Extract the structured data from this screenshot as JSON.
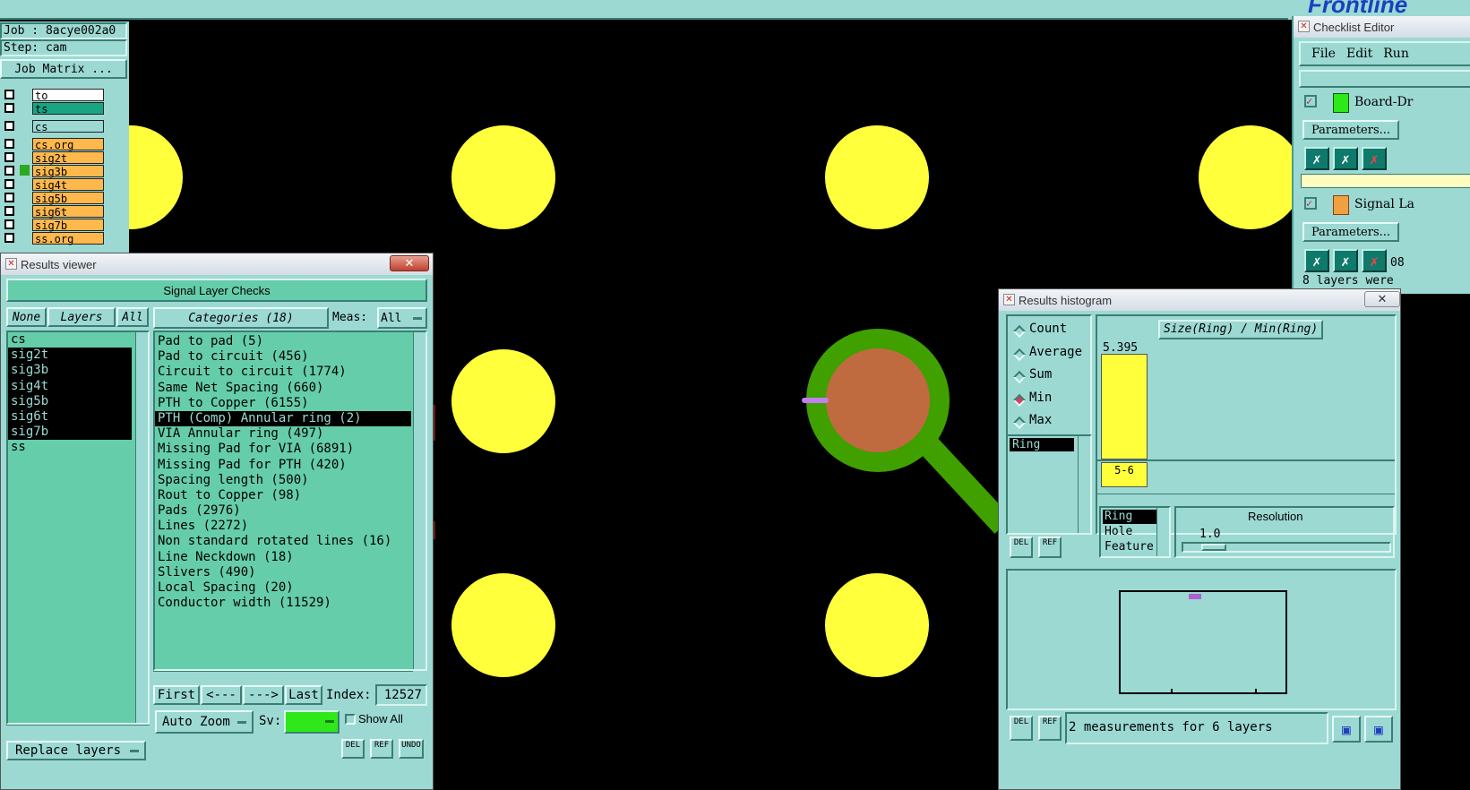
{
  "topbar": {
    "brand": "Frontline"
  },
  "job_panel": {
    "job": "Job : 8acye002a0",
    "step": "Step: cam",
    "matrix_button": "Job Matrix ...",
    "layers": [
      {
        "name": "to",
        "color": "#ffffff",
        "selected": false
      },
      {
        "name": "ts",
        "color": "#1aa582",
        "selected": false
      },
      {
        "name": "cs",
        "color": "#9cd9d3",
        "selected": false
      },
      {
        "name": "cs.org",
        "color": "#ffb84c",
        "selected": false
      },
      {
        "name": "sig2t",
        "color": "#ffb84c",
        "selected": false
      },
      {
        "name": "sig3b",
        "color": "#ffb84c",
        "selected": true
      },
      {
        "name": "sig4t",
        "color": "#ffb84c",
        "selected": false
      },
      {
        "name": "sig5b",
        "color": "#ffb84c",
        "selected": false
      },
      {
        "name": "sig6t",
        "color": "#ffb84c",
        "selected": false
      },
      {
        "name": "sig7b",
        "color": "#ffb84c",
        "selected": false
      },
      {
        "name": "ss.org",
        "color": "#ffb84c",
        "selected": false
      }
    ]
  },
  "results_viewer": {
    "title": "Results viewer",
    "close": "✕",
    "header": "Signal Layer Checks",
    "none_btn": "None",
    "layers_btn": "Layers",
    "all_btn": "All",
    "categories_btn": "Categories (18)",
    "meas_label": "Meas:",
    "meas_value": "All",
    "layers": [
      {
        "name": "cs",
        "selected": false
      },
      {
        "name": "sig2t",
        "selected": true
      },
      {
        "name": "sig3b",
        "selected": true
      },
      {
        "name": "sig4t",
        "selected": true
      },
      {
        "name": "sig5b",
        "selected": true
      },
      {
        "name": "sig6t",
        "selected": true
      },
      {
        "name": "sig7b",
        "selected": true
      },
      {
        "name": "ss",
        "selected": false
      }
    ],
    "categories": [
      {
        "label": "Pad to pad (5)",
        "selected": false
      },
      {
        "label": "Pad to circuit (456)",
        "selected": false
      },
      {
        "label": "Circuit to circuit (1774)",
        "selected": false
      },
      {
        "label": "Same Net Spacing (660)",
        "selected": false
      },
      {
        "label": "PTH to Copper (6155)",
        "selected": false
      },
      {
        "label": "PTH (Comp) Annular ring (2)",
        "selected": true
      },
      {
        "label": "VIA Annular ring (497)",
        "selected": false
      },
      {
        "label": "Missing Pad for VIA (6891)",
        "selected": false
      },
      {
        "label": "Missing Pad for PTH (420)",
        "selected": false
      },
      {
        "label": "Spacing length (500)",
        "selected": false
      },
      {
        "label": "Rout to Copper (98)",
        "selected": false
      },
      {
        "label": "Pads (2976)",
        "selected": false
      },
      {
        "label": "Lines (2272)",
        "selected": false
      },
      {
        "label": "Non standard rotated lines (16)",
        "selected": false
      },
      {
        "label": "Line Neckdown (18)",
        "selected": false
      },
      {
        "label": "Slivers (490)",
        "selected": false
      },
      {
        "label": "Local Spacing (20)",
        "selected": false
      },
      {
        "label": "Conductor width (11529)",
        "selected": false
      }
    ],
    "nav": {
      "first": "First",
      "prev": "<---",
      "next": "--->",
      "last": "Last",
      "index_label": "Index:",
      "index_value": "12527"
    },
    "auto_zoom": "Auto Zoom",
    "sv_label": "Sv:",
    "show_all": "Show All",
    "replace_layers": "Replace layers",
    "del": "DEL",
    "ref": "REF",
    "undo": "UNDO"
  },
  "checklist_editor": {
    "title": "Checklist Editor",
    "menu": [
      "File",
      "Edit",
      "Run"
    ],
    "items": [
      {
        "name": "Board-Dr",
        "params": "Parameters..."
      },
      {
        "name": "Signal La",
        "params": "Parameters..."
      }
    ],
    "suffix_08": "08",
    "status": "8 layers were"
  },
  "histogram": {
    "title": "Results histogram",
    "close": "✕",
    "modes": [
      {
        "label": "Count",
        "on": false
      },
      {
        "label": "Average",
        "on": false
      },
      {
        "label": "Sum",
        "on": false
      },
      {
        "label": "Min",
        "on": true
      },
      {
        "label": "Max",
        "on": false
      }
    ],
    "measure_list": [
      "Ring"
    ],
    "chart_title": "Size(Ring) / Min(Ring)",
    "bar_value": "5.395",
    "bin_label": "5-6",
    "type_list": [
      "Ring",
      "Hole",
      "Feature"
    ],
    "resolution_label": "Resolution",
    "resolution_value": "1.0",
    "status": "2 measurements for 6 layers",
    "del": "DEL",
    "ref": "REF"
  },
  "canvas": {
    "pad_color": "#ffff3c",
    "ring_color": "#3fa000",
    "copper_color": "#c06a40",
    "marker_color": "#c080f0"
  }
}
